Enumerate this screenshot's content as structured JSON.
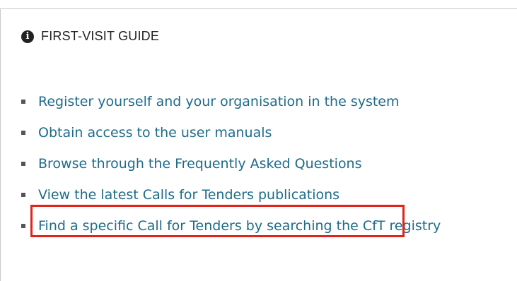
{
  "panel": {
    "title": "FIRST-VISIT GUIDE",
    "icon": "info-icon"
  },
  "guide": {
    "items": [
      {
        "label": "Register yourself and your organisation in the system"
      },
      {
        "label": "Obtain access to the user manuals"
      },
      {
        "label": "Browse through the Frequently Asked Questions"
      },
      {
        "label": "View the latest Calls for Tenders publications"
      },
      {
        "label": "Find a specific Call for Tenders by searching the CfT registry"
      }
    ]
  },
  "annotation": {
    "highlight_color": "#e2231a",
    "highlighted_item_index": 3
  },
  "colors": {
    "link": "#1d6b8a",
    "text": "#222222",
    "border": "#c9c9c9"
  }
}
